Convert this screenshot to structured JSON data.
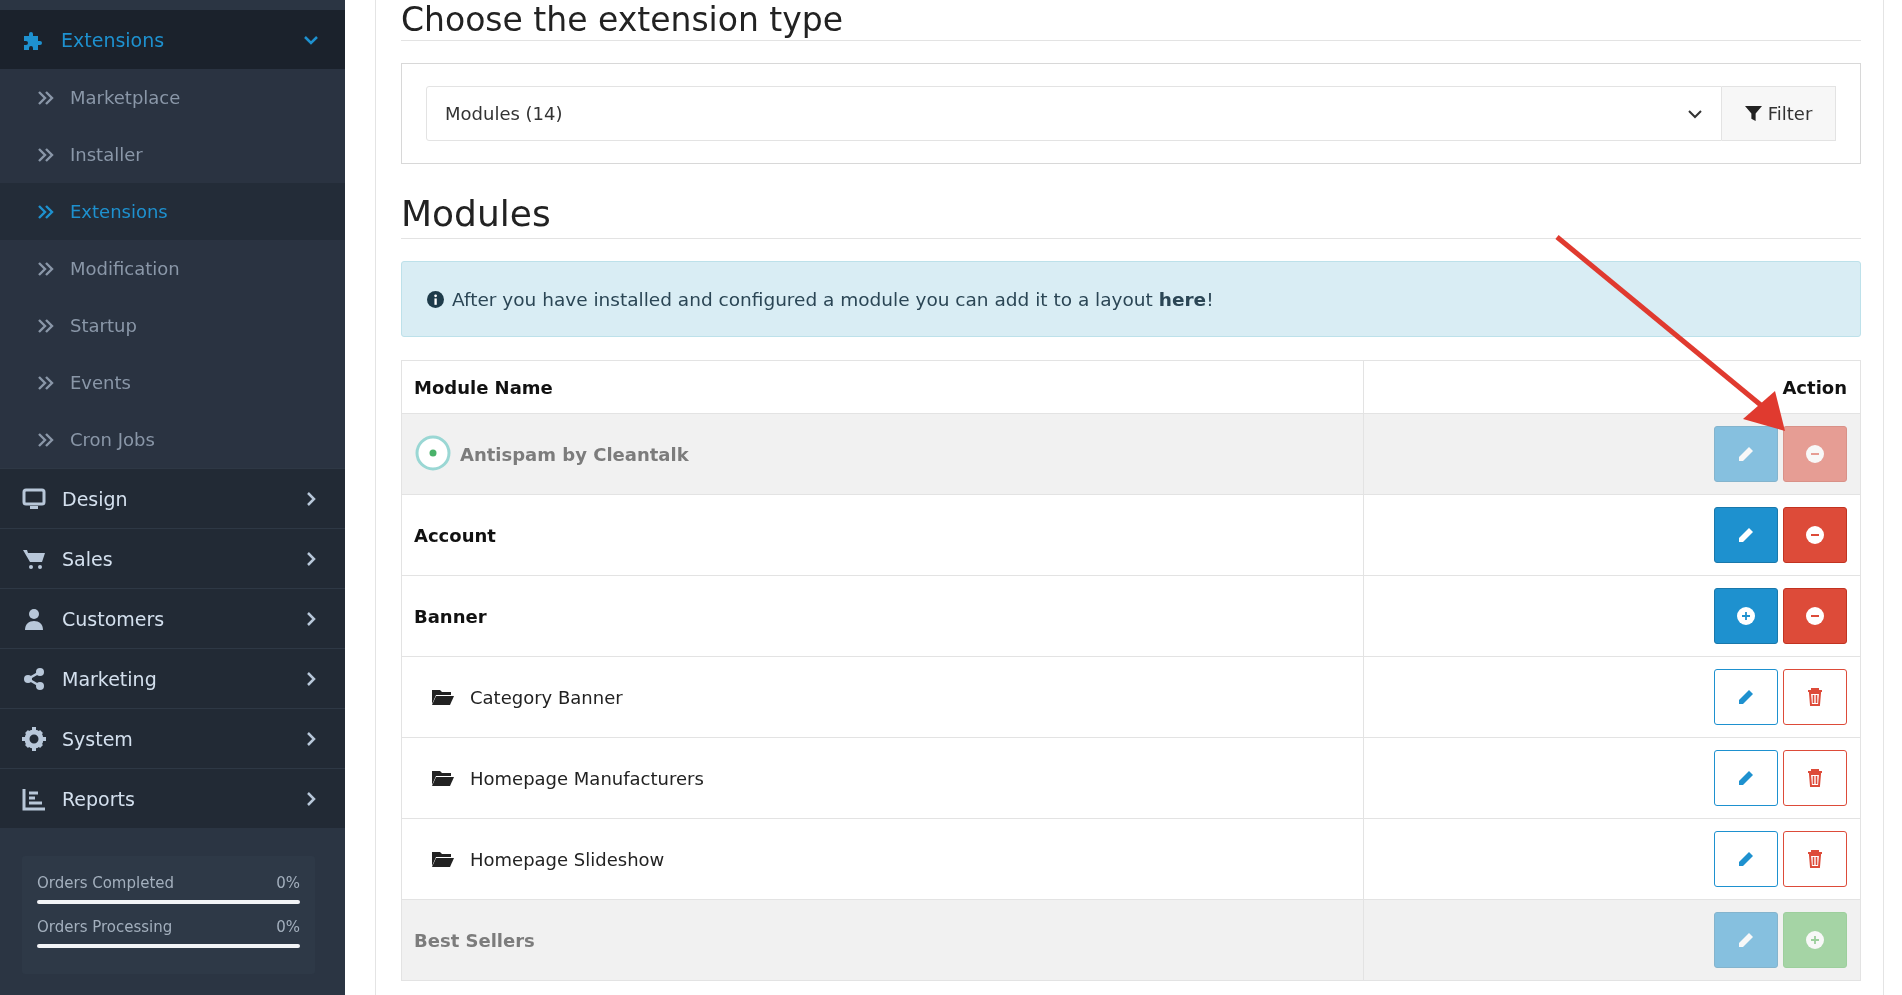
{
  "sidebar": {
    "open_menu": {
      "label": "Extensions",
      "expanded": true,
      "children": [
        {
          "label": "Marketplace",
          "selected": false
        },
        {
          "label": "Installer",
          "selected": false
        },
        {
          "label": "Extensions",
          "selected": true
        },
        {
          "label": "Modification",
          "selected": false
        },
        {
          "label": "Startup",
          "selected": false
        },
        {
          "label": "Events",
          "selected": false
        },
        {
          "label": "Cron Jobs",
          "selected": false
        }
      ]
    },
    "items": [
      {
        "label": "Design"
      },
      {
        "label": "Sales"
      },
      {
        "label": "Customers"
      },
      {
        "label": "Marketing"
      },
      {
        "label": "System"
      },
      {
        "label": "Reports"
      }
    ],
    "stats": [
      {
        "label": "Orders Completed",
        "reading": "0%",
        "level": 0
      },
      {
        "label": "Orders Processing",
        "reading": "0%",
        "level": 0
      }
    ]
  },
  "type_heading": "Choose the extension type",
  "type_select": {
    "value": "Modules (14)"
  },
  "filter_button": "Filter",
  "section_heading": "Modules",
  "alert": "After you have installed and configured a module you can add it to a layout **here**!",
  "table": {
    "columns": [
      "Module Name",
      "Action"
    ],
    "rows": [
      {
        "kind": "module",
        "name": "Antispam by Cleantalk",
        "logo": true,
        "enabled": false,
        "buttons": [
          {
            "kind": "edit"
          },
          {
            "kind": "uninstall"
          }
        ]
      },
      {
        "kind": "module",
        "name": "Account",
        "logo": false,
        "enabled": true,
        "buttons": [
          {
            "kind": "edit"
          },
          {
            "kind": "uninstall"
          }
        ]
      },
      {
        "kind": "module",
        "name": "Banner",
        "logo": false,
        "enabled": true,
        "buttons": [
          {
            "kind": "add"
          },
          {
            "kind": "uninstall"
          }
        ]
      },
      {
        "kind": "instance",
        "name": "Category Banner",
        "logo": false,
        "enabled": true,
        "buttons": [
          {
            "kind": "edit"
          },
          {
            "kind": "delete"
          }
        ]
      },
      {
        "kind": "instance",
        "name": "Homepage Manufacturers",
        "logo": false,
        "enabled": true,
        "buttons": [
          {
            "kind": "edit"
          },
          {
            "kind": "delete"
          }
        ]
      },
      {
        "kind": "instance",
        "name": "Homepage Slideshow",
        "logo": false,
        "enabled": true,
        "buttons": [
          {
            "kind": "edit"
          },
          {
            "kind": "delete"
          }
        ]
      },
      {
        "kind": "module",
        "name": "Best Sellers",
        "logo": false,
        "enabled": false,
        "buttons": [
          {
            "kind": "edit"
          },
          {
            "kind": "install"
          }
        ]
      }
    ]
  }
}
